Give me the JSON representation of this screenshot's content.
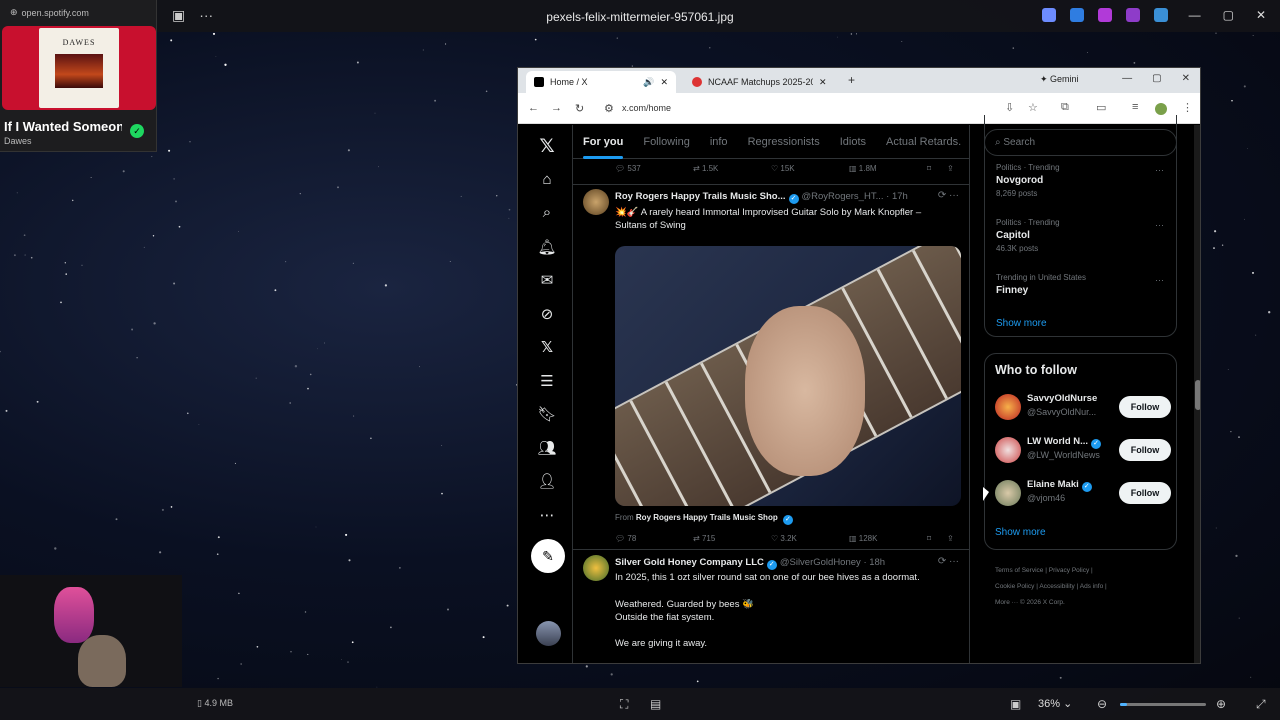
{
  "viewer": {
    "title": "pexels-felix-mittermeier-957061.jpg",
    "file_size": "4.9 MB",
    "zoom": "36%",
    "zoom_fraction": 0.36
  },
  "spotify": {
    "url": "open.spotify.com",
    "song": "If I Wanted Someone",
    "artist": "Dawes",
    "album_text": "DAWES"
  },
  "chrome": {
    "tabs": [
      {
        "label": "Home / X"
      },
      {
        "label": "NCAAF Matchups 2025-2026 -"
      }
    ],
    "gemini_label": "Gemini",
    "url": "x.com/home"
  },
  "x": {
    "feed_tabs": [
      "For you",
      "Following",
      "info",
      "Regressionists",
      "Idiots",
      "Actual Retards."
    ],
    "prev_metrics": [
      "537",
      "1.5K",
      "15K",
      "1.8M"
    ],
    "tweets": [
      {
        "name": "Roy Rogers Happy Trails Music Sho...",
        "handle": "@RoyRogers_HT...",
        "time": "· 17h",
        "text": "💥🎸 A rarely heard Immortal Improvised Guitar Solo by Mark Knopfler – Sultans of Swing",
        "from_label": "From",
        "from_name": "Roy Rogers Happy Trails Music Shop",
        "metrics": [
          "78",
          "715",
          "3.2K",
          "128K"
        ]
      },
      {
        "name": "Silver Gold Honey Company LLC",
        "handle": "@SilverGoldHoney",
        "time": "· 18h",
        "lines": [
          "In 2025, this 1 ozt silver round sat on one of our bee hives as a doormat.",
          "Weathered. Guarded by bees 🐝",
          "Outside the fiat system.",
          "We are giving it away."
        ]
      }
    ],
    "search_placeholder": "Search",
    "trends": [
      {
        "meta": "Politics · Trending",
        "name": "Novgorod",
        "count": "8,269 posts"
      },
      {
        "meta": "Politics · Trending",
        "name": "Capitol",
        "count": "46.3K posts"
      },
      {
        "meta": "Trending in United States",
        "name": "Finney",
        "count": ""
      }
    ],
    "show_more": "Show more",
    "who_to_follow": {
      "title": "Who to follow",
      "users": [
        {
          "name": "SavvyOldNurse",
          "handle": "@SavvyOldNur...",
          "verified": false
        },
        {
          "name": "LW World N...",
          "handle": "@LW_WorldNews",
          "verified": true
        },
        {
          "name": "Elaine Maki",
          "handle": "@vjom46",
          "verified": true
        }
      ],
      "follow_label": "Follow",
      "show_more": "Show more"
    },
    "footer": {
      "line1": [
        "Terms of Service",
        "|",
        "Privacy Policy",
        "|"
      ],
      "line2": [
        "Cookie Policy",
        "|",
        "Accessibility",
        "|",
        "Ads info",
        "|"
      ],
      "line3": [
        "More ···",
        "© 2026 X Corp."
      ]
    }
  }
}
